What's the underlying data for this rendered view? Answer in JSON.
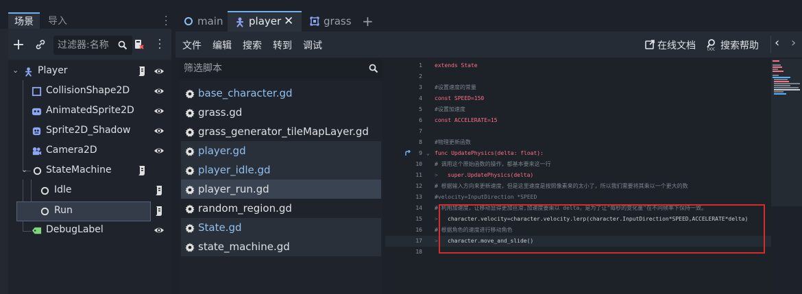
{
  "dock": {
    "tabs": [
      "场景",
      "导入"
    ],
    "filter_placeholder": "过滤器:名称"
  },
  "tree": [
    {
      "label": "Player",
      "icon": "player-node-icon",
      "script": true,
      "eye": true
    },
    {
      "label": "CollisionShape2D",
      "icon": "collision-shape-icon",
      "script": false,
      "eye": true
    },
    {
      "label": "AnimatedSprite2D",
      "icon": "animated-sprite-icon",
      "script": false,
      "eye": true
    },
    {
      "label": "Sprite2D_Shadow",
      "icon": "sprite2d-icon",
      "script": false,
      "eye": true
    },
    {
      "label": "Camera2D",
      "icon": "camera2d-icon",
      "script": false,
      "eye": true
    },
    {
      "label": "StateMachine",
      "icon": "node-icon",
      "script": true,
      "eye": false
    },
    {
      "label": "Idle",
      "icon": "node-icon",
      "script": true,
      "eye": false
    },
    {
      "label": "Run",
      "icon": "node-icon",
      "script": true,
      "eye": false
    },
    {
      "label": "DebugLabel",
      "icon": "label-node-icon",
      "script": false,
      "eye": true
    }
  ],
  "main_tabs": [
    "main",
    "player",
    "grass"
  ],
  "menu": [
    "文件",
    "编辑",
    "搜索",
    "转到",
    "调试"
  ],
  "help": {
    "online_docs": "在线文档",
    "search_help": "搜索帮助"
  },
  "script_filter_placeholder": "筛选脚本",
  "scripts": [
    {
      "name": "base_character.gd",
      "blue": true
    },
    {
      "name": "grass.gd",
      "blue": false
    },
    {
      "name": "grass_generator_tileMapLayer.gd",
      "blue": false
    },
    {
      "name": "player.gd",
      "blue": true
    },
    {
      "name": "player_idle.gd",
      "blue": true
    },
    {
      "name": "player_run.gd",
      "blue": false
    },
    {
      "name": "random_region.gd",
      "blue": false
    },
    {
      "name": "State.gd",
      "blue": true
    },
    {
      "name": "state_machine.gd",
      "blue": false
    }
  ],
  "code": [
    {
      "n": "1",
      "t": "extends State"
    },
    {
      "n": "2",
      "t": ""
    },
    {
      "n": "3",
      "t": "#设置速度的常量"
    },
    {
      "n": "4",
      "t": "const SPEED=150"
    },
    {
      "n": "5",
      "t": "#设置加速度"
    },
    {
      "n": "6",
      "t": "const ACCELERATE=15"
    },
    {
      "n": "7",
      "t": ""
    },
    {
      "n": "8",
      "t": "#物理更新函数"
    },
    {
      "n": "9",
      "t": "func UpdatePhysics(delta: float):"
    },
    {
      "n": "10",
      "t": "#  调用这个原始函数的操作，都基本要来这一行"
    },
    {
      "n": "11",
      "t": "super.UpdatePhysics(delta)"
    },
    {
      "n": "12",
      "t": "#  根据输入方向来更新速度，但是这里速度是按照像素来的太小了，所以我们需要将其乘以一个更大的数"
    },
    {
      "n": "13",
      "t": "#velocity=InputDirection *SPEED"
    },
    {
      "n": "14",
      "t": "#  利用加速度，让移动显得更加丝滑,加速度要乘以 delta，是为了让\"每秒的变化量\"在不同帧率下保持一致。"
    },
    {
      "n": "15",
      "t": "character.velocity=character.velocity.lerp(character.InputDirection*SPEED,ACCELERATE*delta)"
    },
    {
      "n": "16",
      "t": "#  根据角色的速度进行移动角色"
    },
    {
      "n": "17",
      "t": "character.move_and_slide()"
    },
    {
      "n": "18",
      "t": ""
    }
  ]
}
